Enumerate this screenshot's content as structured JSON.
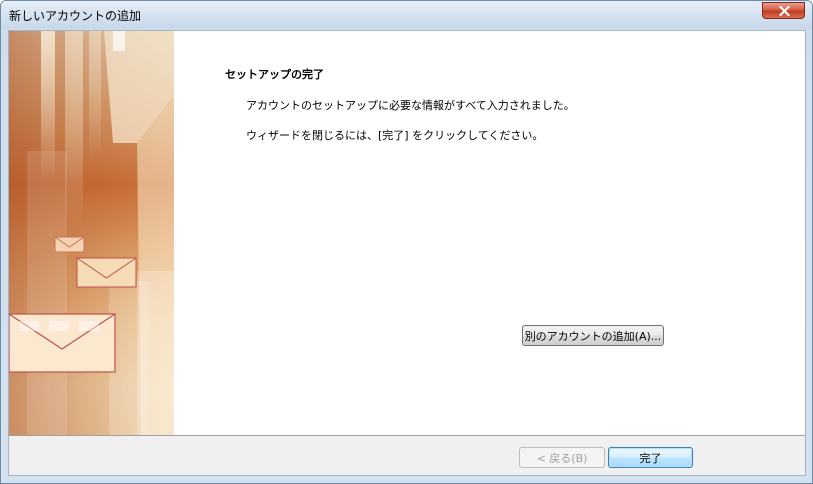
{
  "window": {
    "title": "新しいアカウントの追加"
  },
  "content": {
    "heading": "セットアップの完了",
    "line1": "アカウントのセットアップに必要な情報がすべて入力されました。",
    "line2": "ウィザードを閉じるには、[完了] をクリックしてください。",
    "add_account_button": "別のアカウントの追加(A)..."
  },
  "footer": {
    "back_button": "< 戻る(B)",
    "finish_button": "完了"
  },
  "colors": {
    "banner_orange": "#c96a2c",
    "banner_light": "#f6dcb0",
    "envelope_stroke": "#c0504d",
    "finish_border": "#3c7fb1"
  },
  "icons": {
    "close": "close-icon",
    "envelope": "envelope-icon"
  }
}
